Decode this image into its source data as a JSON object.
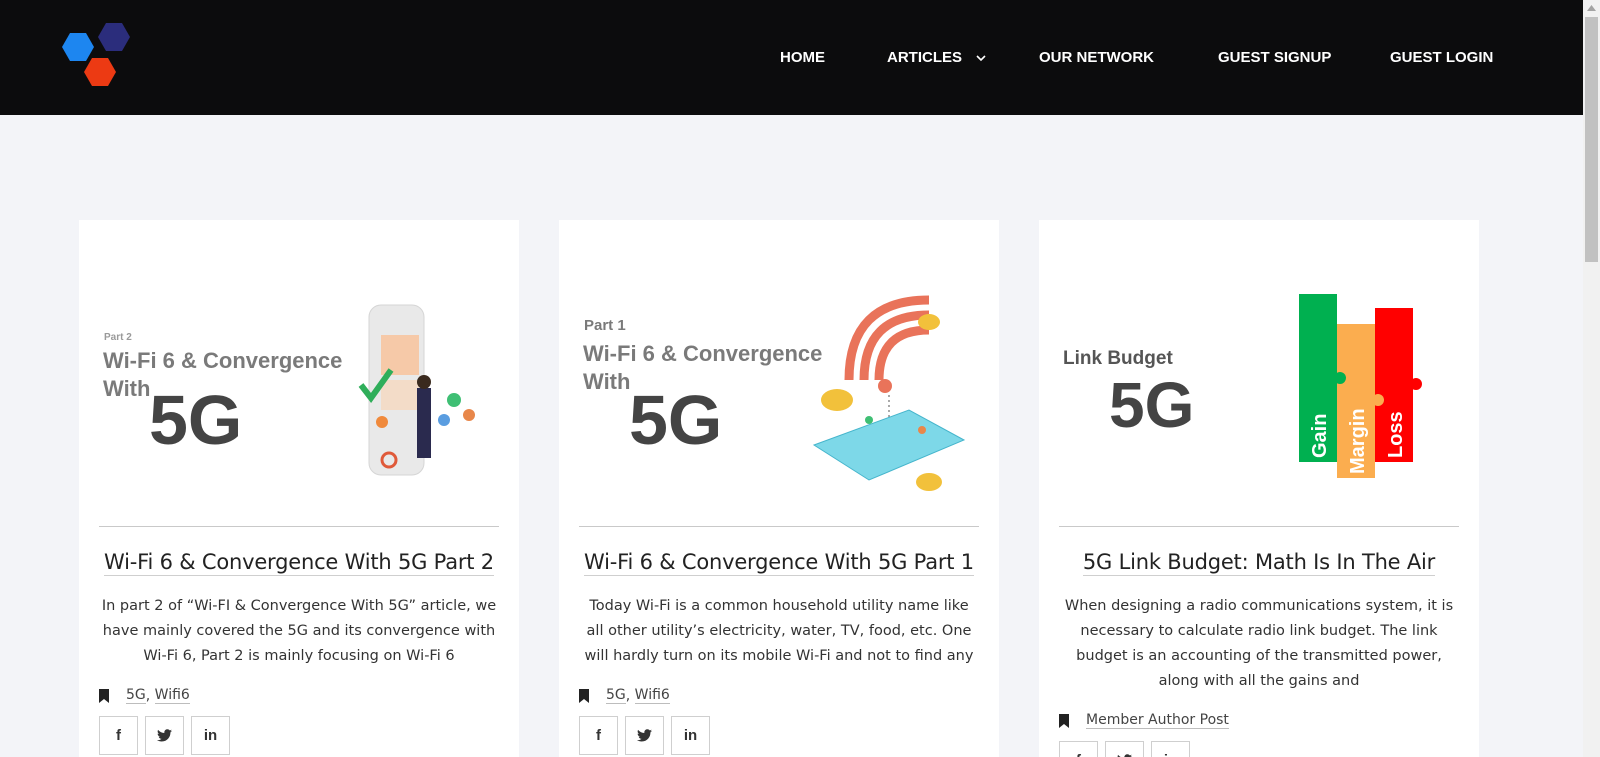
{
  "nav": {
    "items": [
      {
        "label": "HOME"
      },
      {
        "label": "ARTICLES"
      },
      {
        "label": "OUR NETWORK"
      },
      {
        "label": "GUEST SIGNUP"
      },
      {
        "label": "GUEST LOGIN"
      }
    ]
  },
  "cards": [
    {
      "image": {
        "part": "Part 2",
        "line1": "Wi-Fi 6 & Convergence",
        "line2": "With",
        "big": "5G"
      },
      "title": "Wi-Fi 6 & Convergence With 5G Part 2",
      "excerpt": "In part 2 of “Wi-FI & Convergence With 5G” article, we have mainly covered the 5G and its convergence with Wi-Fi 6, Part 2 is mainly focusing on Wi-Fi 6",
      "tags": [
        "5G",
        "Wifi6"
      ]
    },
    {
      "image": {
        "part": "Part 1",
        "line1": "Wi-Fi 6 & Convergence",
        "line2": "With",
        "big": "5G"
      },
      "title": "Wi-Fi 6 & Convergence With 5G Part 1",
      "excerpt": "Today Wi-Fi is a common household utility name like all other utility’s electricity, water, TV, food, etc. One will hardly turn on its mobile Wi-Fi and not to find any",
      "tags": [
        "5G",
        "Wifi6"
      ]
    },
    {
      "image": {
        "label": "Link Budget",
        "big": "5G",
        "bars": [
          "Gain",
          "Margin",
          "Loss"
        ]
      },
      "title": "5G Link Budget: Math Is In The Air",
      "excerpt": "When designing a radio communications system, it is necessary to calculate radio link budget. The link budget is an accounting of the transmitted power, along with all the gains and",
      "tags": [
        "Member Author Post"
      ]
    }
  ],
  "social": {
    "facebook": "f",
    "linkedin": "in"
  },
  "colors": {
    "header_bg": "#0c0c0d",
    "page_bg": "#f3f4f8",
    "logo_blue": "#1d86f0",
    "logo_navy": "#2b2d7c",
    "logo_red": "#ec3a13",
    "gain_green": "#00b050",
    "margin_orange": "#fbad4f",
    "loss_red": "#ff0000"
  }
}
